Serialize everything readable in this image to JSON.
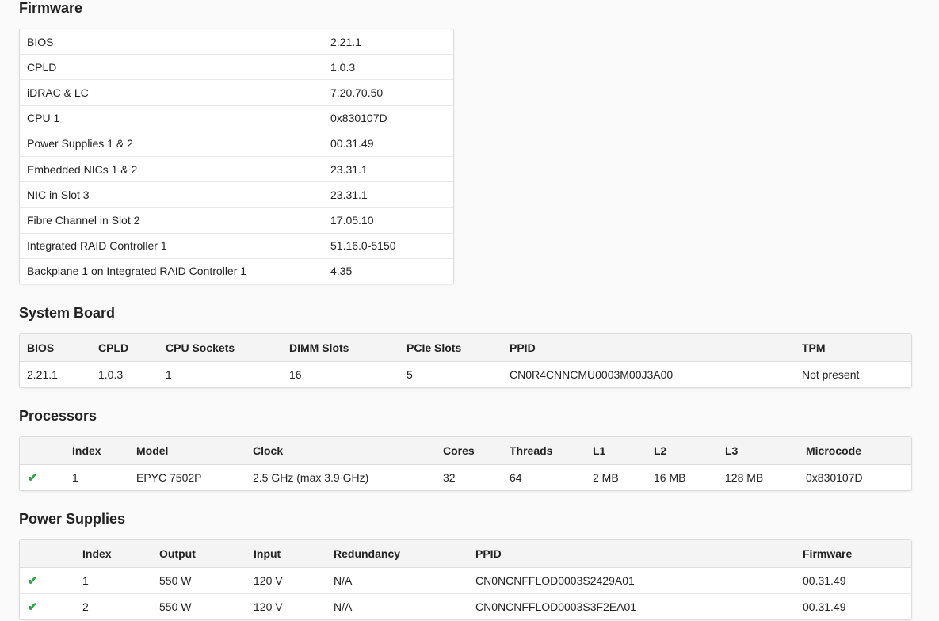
{
  "firmware": {
    "title": "Firmware",
    "rows": [
      [
        "BIOS",
        "2.21.1"
      ],
      [
        "CPLD",
        "1.0.3"
      ],
      [
        "iDRAC & LC",
        "7.20.70.50"
      ],
      [
        "CPU 1",
        "0x830107D"
      ],
      [
        "Power Supplies 1 & 2",
        "00.31.49"
      ],
      [
        "Embedded NICs 1 & 2",
        "23.31.1"
      ],
      [
        "NIC in Slot 3",
        "23.31.1"
      ],
      [
        "Fibre Channel in Slot 2",
        "17.05.10"
      ],
      [
        "Integrated RAID Controller 1",
        "51.16.0-5150"
      ],
      [
        "Backplane 1 on Integrated RAID Controller 1",
        "4.35"
      ]
    ]
  },
  "system_board": {
    "title": "System Board",
    "headers": [
      "BIOS",
      "CPLD",
      "CPU Sockets",
      "DIMM Slots",
      "PCIe Slots",
      "PPID",
      "TPM"
    ],
    "rows": [
      [
        "2.21.1",
        "1.0.3",
        "1",
        "16",
        "5",
        "CN0R4CNNCMU0003M00J3A00",
        "Not present"
      ]
    ]
  },
  "processors": {
    "title": "Processors",
    "headers": [
      "",
      "Index",
      "Model",
      "Clock",
      "Cores",
      "Threads",
      "L1",
      "L2",
      "L3",
      "Microcode"
    ],
    "rows": [
      [
        "check-icon",
        "1",
        "EPYC 7502P",
        "2.5 GHz (max 3.9 GHz)",
        "32",
        "64",
        "2 MB",
        "16 MB",
        "128 MB",
        "0x830107D"
      ]
    ]
  },
  "power_supplies": {
    "title": "Power Supplies",
    "headers": [
      "",
      "Index",
      "Output",
      "Input",
      "Redundancy",
      "PPID",
      "Firmware"
    ],
    "rows": [
      [
        "check-icon",
        "1",
        "550 W",
        "120 V",
        "N/A",
        "CN0NCNFFLOD0003S2429A01",
        "00.31.49"
      ],
      [
        "check-icon",
        "2",
        "550 W",
        "120 V",
        "N/A",
        "CN0NCNFFLOD0003S3F2EA01",
        "00.31.49"
      ]
    ]
  },
  "colors": {
    "status_ok": "#2aa345"
  }
}
